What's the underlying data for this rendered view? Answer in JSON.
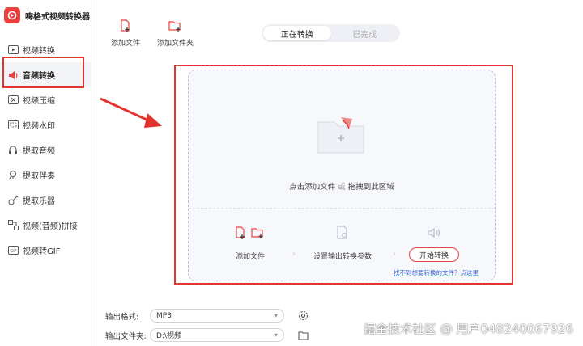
{
  "app": {
    "title": "嗨格式视频转换器"
  },
  "sidebar": {
    "items": [
      {
        "label": "视频转换",
        "icon": "video-convert-icon"
      },
      {
        "label": "音频转换",
        "icon": "audio-convert-icon",
        "active": true
      },
      {
        "label": "视频压缩",
        "icon": "video-compress-icon"
      },
      {
        "label": "视频水印",
        "icon": "video-watermark-icon"
      },
      {
        "label": "提取音频",
        "icon": "extract-audio-icon"
      },
      {
        "label": "提取伴奏",
        "icon": "extract-accompaniment-icon"
      },
      {
        "label": "提取乐器",
        "icon": "extract-instrument-icon"
      },
      {
        "label": "视频(音频)拼接",
        "icon": "merge-icon"
      },
      {
        "label": "视频转GIF",
        "icon": "gif-icon"
      }
    ]
  },
  "toolbar": {
    "add_file": "添加文件",
    "add_folder": "添加文件夹"
  },
  "tabs": {
    "converting": "正在转换",
    "completed": "已完成"
  },
  "dropzone": {
    "hint_click": "点击添加文件",
    "hint_or": "或",
    "hint_drag": "拖拽到此区域",
    "steps": {
      "add_file": "添加文件",
      "set_params": "设置输出转换参数",
      "start": "开始转换"
    },
    "help_link": "找不到想要转换的文件？点这里"
  },
  "settings": {
    "format_label": "输出格式:",
    "format_value": "MP3",
    "folder_label": "输出文件夹:",
    "folder_value": "D:\\视频"
  },
  "watermark": "掘金技术社区 @ 用户048240067926",
  "colors": {
    "accent": "#e8413d",
    "annotation": "#e2342f",
    "link": "#3a6fd8"
  }
}
